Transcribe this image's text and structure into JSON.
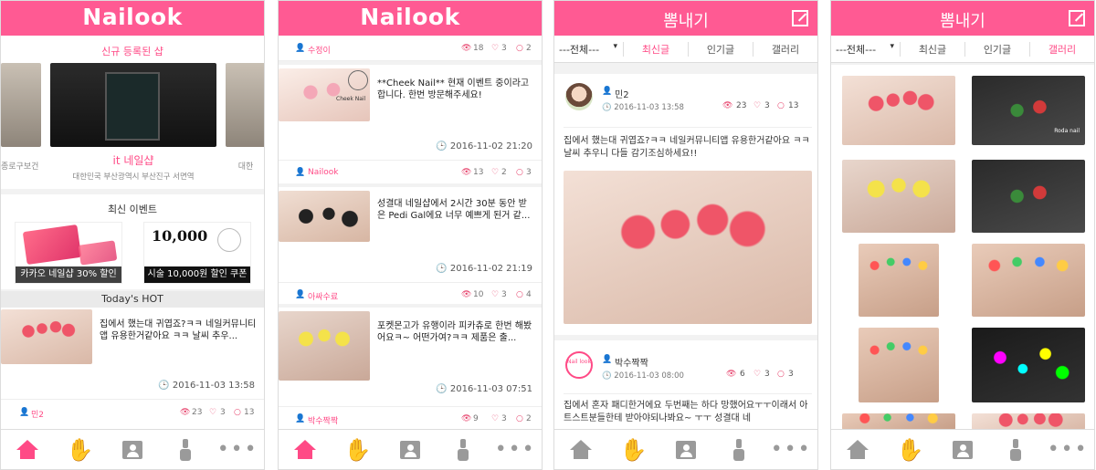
{
  "colors": {
    "brand": "#ff5a93",
    "accent": "#ff4a86",
    "heart": "#e7456e"
  },
  "screen1": {
    "logo": "Nailook",
    "new_shop_title": "신규 등록된 샵",
    "shop_name": "it 네일샵",
    "shop_addr": "대한민국 부산광역시 부산진구 서면역",
    "side_left_text": "종로구보건",
    "side_right_text": "대한",
    "events_title": "최신 이벤트",
    "event1_label": "카카오 네일샵 30% 할인",
    "event2_label": "시술 10,000원 할인 쿠폰",
    "event2_price": "10,000",
    "hot_title": "Today's HOT",
    "hot_text": "집에서 했는대 귀엽죠?ㅋㅋ 네일커뮤니티앱 유용한거같아요 ㅋㅋ 날씨 추우...",
    "hot_date": "2016-11-03 13:58",
    "hot_user": "민2",
    "hot_views": "23",
    "hot_likes": "3",
    "hot_comments": "13"
  },
  "screen2": {
    "logo": "Nailook",
    "top_user": "수정이",
    "top_views": "18",
    "top_likes": "3",
    "top_comments": "2",
    "posts": [
      {
        "text": "**Cheek Nail** 현재 이벤트 중이라고 합니다. 한번 방문해주세요!",
        "date": "2016-11-02 21:20",
        "user": "Nailook",
        "views": "13",
        "likes": "2",
        "comments": "3",
        "brand": "Cheek Nail"
      },
      {
        "text": "성결대 네일샵에서 2시간 30분 동안 받은 Pedi Gal에요 너무 예쁘게 된거 같...",
        "date": "2016-11-02 21:19",
        "user": "아싸수료",
        "views": "10",
        "likes": "3",
        "comments": "4"
      },
      {
        "text": "포켓몬고가 유행이라 피카츄로 한번 해봤어요ㅋ~ 어떤가여?ㅋㅋ 제품은 출...",
        "date": "2016-11-03 07:51",
        "user": "박수짝짝",
        "views": "9",
        "likes": "3",
        "comments": "2"
      }
    ]
  },
  "screen3": {
    "title": "뽐내기",
    "filter_select": "---전체---",
    "tabs": [
      "최신글",
      "인기글",
      "갤러리"
    ],
    "posts": [
      {
        "user": "민2",
        "date": "2016-11-03 13:58",
        "views": "23",
        "likes": "3",
        "comments": "13",
        "text": "집에서 했는대 귀엽죠?ㅋㅋ 네일커뮤니티앱 유용한거같아요 ㅋㅋ 날씨 추우니 다들 감기조심하세요!!"
      },
      {
        "user": "박수짝짝",
        "date": "2016-11-03 08:00",
        "views": "6",
        "likes": "3",
        "comments": "3",
        "text": "집에서 혼자 패디한거에요 두번째는 하다 망했어요ㅜㅜ이래서 아트스트분들한테 받아야되나봐요~ ㅜㅜ 성결대 네",
        "avatar": "Nail look"
      }
    ]
  },
  "screen4": {
    "title": "뽐내기",
    "filter_select": "---전체---",
    "tabs": [
      "최신글",
      "인기글",
      "갤러리"
    ],
    "gallery_caption": "Roda nail"
  },
  "nav": {
    "icons": [
      "home-icon",
      "hand-icon",
      "profile-icon",
      "polish-icon",
      "more-icon"
    ],
    "more_glyph": "•••",
    "hand_glyph": "✋"
  }
}
